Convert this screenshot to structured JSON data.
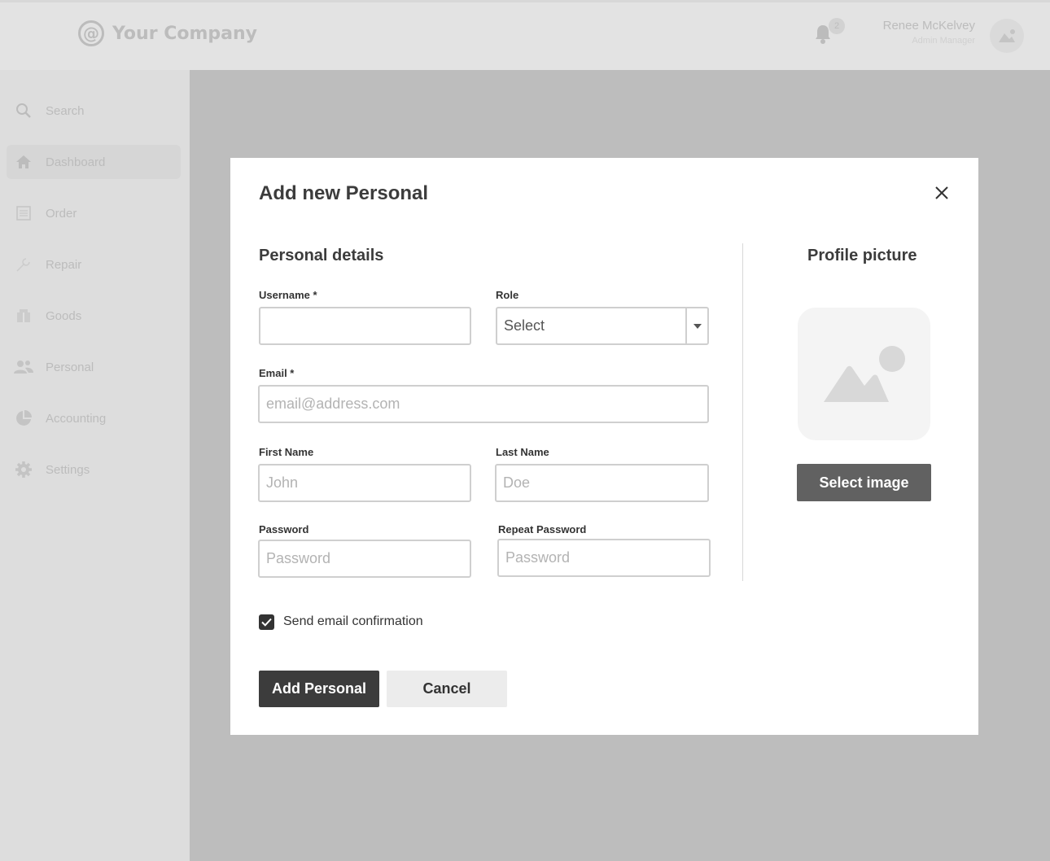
{
  "header": {
    "brand_name": "Your Company",
    "notification_count": "2",
    "user_name": "Renee McKelvey",
    "user_role": "Admin Manager"
  },
  "sidebar": {
    "items": [
      {
        "label": "Search",
        "icon": "search-icon"
      },
      {
        "label": "Dashboard",
        "icon": "home-icon"
      },
      {
        "label": "Order",
        "icon": "order-icon"
      },
      {
        "label": "Repair",
        "icon": "repair-icon"
      },
      {
        "label": "Goods",
        "icon": "goods-icon"
      },
      {
        "label": "Personal",
        "icon": "people-icon"
      },
      {
        "label": "Accounting",
        "icon": "pie-chart-icon"
      },
      {
        "label": "Settings",
        "icon": "gear-icon"
      }
    ],
    "active": "Dashboard"
  },
  "modal": {
    "title": "Add new Personal",
    "details_title": "Personal details",
    "username_label": "Username *",
    "username_value": "",
    "role_label": "Role",
    "role_value": "Select",
    "email_label": "Email *",
    "email_placeholder": "email@address.com",
    "first_name_label": "First Name",
    "first_name_placeholder": "John",
    "last_name_label": "Last Name",
    "last_name_placeholder": "Doe",
    "password_label": "Password",
    "password_placeholder": "Password",
    "repeat_password_label": "Repeat Password",
    "repeat_password_placeholder": "Password",
    "profile_title": "Profile picture",
    "select_image_label": "Select image",
    "email_confirmation_label": "Send email confirmation",
    "email_confirmation_checked": true,
    "submit_label": "Add Personal",
    "cancel_label": "Cancel"
  },
  "colors": {
    "primary_button": "#3c3c3c",
    "secondary_button": "#ececec",
    "overlay": "#bdbdbd"
  }
}
